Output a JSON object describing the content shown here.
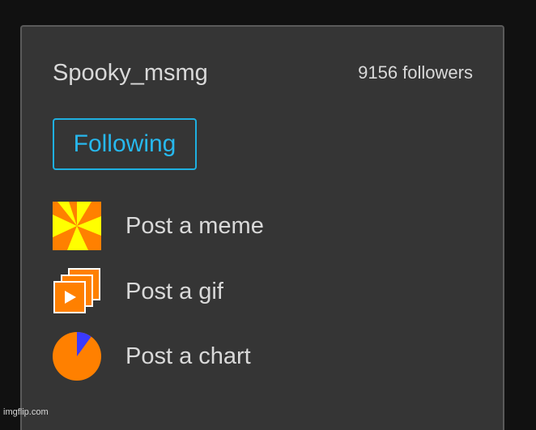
{
  "profile": {
    "username": "Spooky_msmg",
    "followers_text": "9156 followers",
    "follow_button_label": "Following"
  },
  "actions": [
    {
      "label": "Post a meme",
      "icon": "meme-pinwheel-icon"
    },
    {
      "label": "Post a gif",
      "icon": "gif-frames-play-icon"
    },
    {
      "label": "Post a chart",
      "icon": "pie-chart-icon"
    }
  ],
  "watermark": "imgflip.com",
  "colors": {
    "page_background": "#111111",
    "panel_background": "#353535",
    "text": "#d9d9d9",
    "accent": "#27b8ee",
    "icon_orange": "#ff8000",
    "icon_yellow": "#ffff00",
    "chart_blue": "#3a3aff"
  }
}
